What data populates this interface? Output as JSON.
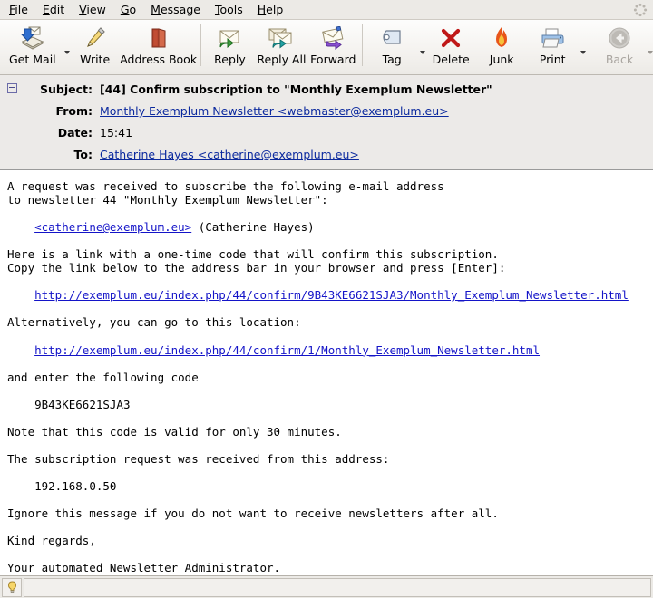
{
  "menubar": {
    "items": [
      {
        "pre": "",
        "mn": "F",
        "post": "ile"
      },
      {
        "pre": "",
        "mn": "E",
        "post": "dit"
      },
      {
        "pre": "",
        "mn": "V",
        "post": "iew"
      },
      {
        "pre": "",
        "mn": "G",
        "post": "o"
      },
      {
        "pre": "",
        "mn": "M",
        "post": "essage"
      },
      {
        "pre": "",
        "mn": "T",
        "post": "ools"
      },
      {
        "pre": "",
        "mn": "H",
        "post": "elp"
      }
    ],
    "throbber_icon": "throbber-icon"
  },
  "toolbar": {
    "buttons": [
      {
        "label": "Get Mail",
        "icon": "get-mail-icon",
        "dropdown": true,
        "disabled": false
      },
      {
        "label": "Write",
        "icon": "write-pencil-icon",
        "dropdown": false,
        "disabled": false
      },
      {
        "label": "Address Book",
        "icon": "address-book-icon",
        "dropdown": false,
        "disabled": false
      },
      {
        "label": "Reply",
        "icon": "reply-icon",
        "dropdown": false,
        "disabled": false
      },
      {
        "label": "Reply All",
        "icon": "reply-all-icon",
        "dropdown": false,
        "disabled": false
      },
      {
        "label": "Forward",
        "icon": "forward-icon",
        "dropdown": false,
        "disabled": false
      },
      {
        "label": "Tag",
        "icon": "tag-icon",
        "dropdown": true,
        "disabled": false
      },
      {
        "label": "Delete",
        "icon": "delete-x-icon",
        "dropdown": false,
        "disabled": false
      },
      {
        "label": "Junk",
        "icon": "junk-flame-icon",
        "dropdown": false,
        "disabled": false
      },
      {
        "label": "Print",
        "icon": "print-icon",
        "dropdown": true,
        "disabled": false
      },
      {
        "label": "Back",
        "icon": "back-arrow-icon",
        "dropdown": true,
        "disabled": true
      }
    ]
  },
  "headers": {
    "subject_label": "Subject:",
    "subject_value": "[44] Confirm subscription to \"Monthly Exemplum Newsletter\"",
    "from_label": "From:",
    "from_value": "Monthly Exemplum Newsletter <webmaster@exemplum.eu>",
    "date_label": "Date:",
    "date_value": "15:41",
    "to_label": "To:",
    "to_value": "Catherine Hayes <catherine@exemplum.eu>"
  },
  "message": {
    "line1": "A request was received to subscribe the following e-mail address",
    "line2": "to newsletter 44 \"Monthly Exemplum Newsletter\":",
    "subscriber_link": "<catherine@exemplum.eu>",
    "subscriber_name": " (Catherine Hayes)",
    "line3": "Here is a link with a one-time code that will confirm this subscription.",
    "line4": "Copy the link below to the address bar in your browser and press [Enter]:",
    "confirm_url": "http://exemplum.eu/index.php/44/confirm/9B43KE6621SJA3/Monthly_Exemplum_Newsletter.html",
    "line5": "Alternatively, you can go to this location:",
    "alt_url": "http://exemplum.eu/index.php/44/confirm/1/Monthly_Exemplum_Newsletter.html",
    "line6": "and enter the following code",
    "code": "9B43KE6621SJA3",
    "line7": "Note that this code is valid for only 30 minutes.",
    "line8": "The subscription request was received from this address:",
    "ip_address": "192.168.0.50",
    "line9": "Ignore this message if you do not want to receive newsletters after all.",
    "line10": "Kind regards,",
    "line11": "Your automated Newsletter Administrator."
  },
  "statusbar": {
    "icon": "lightbulb-icon",
    "text": ""
  },
  "colors": {
    "link": "#1414c8",
    "header_link": "#0b299e",
    "header_bg": "#eceae8",
    "toolbar_bg": "#f4f2ef",
    "chrome_bg": "#eceae6"
  }
}
